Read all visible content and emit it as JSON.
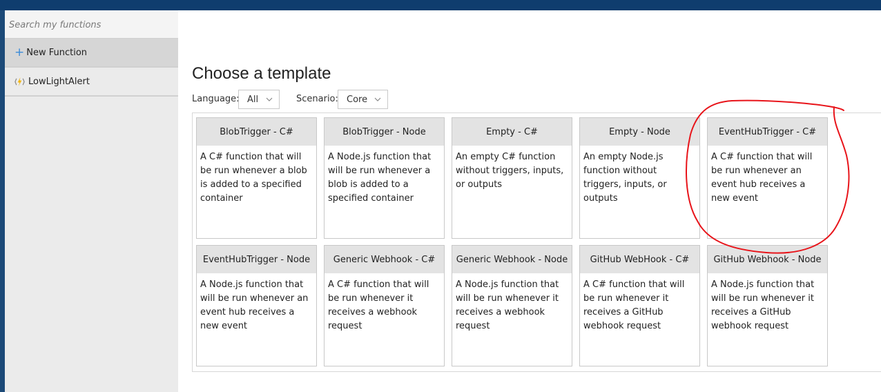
{
  "sidebar": {
    "search_placeholder": "Search my functions",
    "new_function_label": "New Function",
    "function_items": [
      "LowLightAlert"
    ]
  },
  "main": {
    "title": "Choose a template",
    "language": {
      "label": "Language:",
      "selected": "All"
    },
    "scenario": {
      "label": "Scenario:",
      "selected": "Core"
    }
  },
  "templates": [
    {
      "title": "BlobTrigger - C#",
      "description": "A C# function that will be run whenever a blob is added to a specified container"
    },
    {
      "title": "BlobTrigger - Node",
      "description": "A Node.js function that will be run whenever a blob is added to a specified container"
    },
    {
      "title": "Empty - C#",
      "description": "An empty C# function without triggers, inputs, or outputs"
    },
    {
      "title": "Empty - Node",
      "description": "An empty Node.js function without triggers, inputs, or outputs"
    },
    {
      "title": "EventHubTrigger - C#",
      "description": "A C# function that will be run whenever an event hub receives a new event"
    },
    {
      "title": "EventHubTrigger - Node",
      "description": "A Node.js function that will be run whenever an event hub receives a new event"
    },
    {
      "title": "Generic Webhook - C#",
      "description": "A C# function that will be run whenever it receives a webhook request"
    },
    {
      "title": "Generic Webhook - Node",
      "description": "A Node.js function that will be run whenever it receives a webhook request"
    },
    {
      "title": "GitHub WebHook - C#",
      "description": "A C# function that will be run whenever it receives a GitHub webhook request"
    },
    {
      "title": "GitHub Webhook - Node",
      "description": "A Node.js function that will be run whenever it receives a GitHub webhook request"
    }
  ],
  "colors": {
    "top_bar": "#0f3d6e",
    "annotation": "#e8141a",
    "plus_icon": "#3a8bd8",
    "card_header": "#e3e3e3"
  },
  "icons": {
    "new_function": "plus-icon",
    "function_item": "function-bolt-icon",
    "dropdown": "chevron-down-icon"
  }
}
